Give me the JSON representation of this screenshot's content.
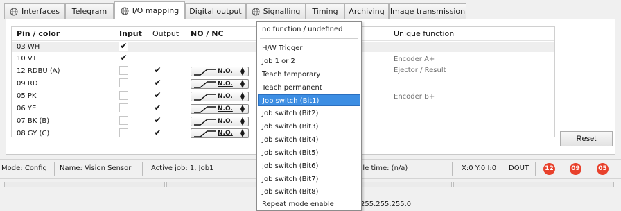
{
  "tabs": [
    {
      "label": "Interfaces",
      "icon": "globe-icon"
    },
    {
      "label": "Telegram"
    },
    {
      "label": "I/O mapping",
      "icon": "globe-icon",
      "active": true
    },
    {
      "label": "Digital output"
    },
    {
      "label": "Signalling",
      "icon": "globe-icon"
    },
    {
      "label": "Timing"
    },
    {
      "label": "Archiving"
    },
    {
      "label": "Image transmission"
    }
  ],
  "table": {
    "headers": {
      "pin": "Pin / color",
      "input": "Input",
      "output": "Output",
      "nonc": "NO / NC",
      "unique": "Unique function"
    },
    "rows": [
      {
        "pin": "03 WH",
        "input": true,
        "output": null,
        "nonc": null,
        "unique": "H/W Trigger",
        "highlight": true
      },
      {
        "pin": "10 VT",
        "input": true,
        "output": null,
        "nonc": null,
        "unique": "Encoder A+"
      },
      {
        "pin": "12 RDBU (A)",
        "input": false,
        "output": true,
        "nonc": "N.O.",
        "unique": "Ejector / Result"
      },
      {
        "pin": "09 RD",
        "input": false,
        "output": true,
        "nonc": "N.O.",
        "unique": ""
      },
      {
        "pin": "05 PK",
        "input": false,
        "output": true,
        "nonc": "N.O.",
        "unique": "Encoder B+"
      },
      {
        "pin": "06 YE",
        "input": false,
        "output": true,
        "nonc": "N.O.",
        "unique": ""
      },
      {
        "pin": "07 BK (B)",
        "input": false,
        "output": true,
        "nonc": "N.O.",
        "unique": ""
      },
      {
        "pin": "08 GY (C)",
        "input": false,
        "output": true,
        "nonc": "N.O.",
        "unique": ""
      }
    ]
  },
  "reset_label": "Reset",
  "status": {
    "mode_label": "Mode:",
    "mode_value": "Config",
    "name_label": "Name:",
    "name_value": "Vision Sensor",
    "active_job_label": "Active job:",
    "active_job_value": "1, Job1",
    "cycle_label": "Cycle time:",
    "cycle_value": "(n/a)",
    "coords": "X:0 Y:0 I:0",
    "dout": "DOUT",
    "leds": [
      "12",
      "09",
      "05"
    ],
    "led_color": "#e8412c"
  },
  "ip_fragment": "255.255.255.0",
  "dropdown": {
    "items": [
      "no function / undefined",
      "H/W Trigger",
      "Job 1 or 2",
      "Teach temporary",
      "Teach permanent",
      "Job switch (Bit1)",
      "Job switch (Bit2)",
      "Job switch (Bit3)",
      "Job switch (Bit4)",
      "Job switch (Bit5)",
      "Job switch (Bit6)",
      "Job switch (Bit7)",
      "Job switch (Bit8)",
      "Repeat mode enable"
    ],
    "selected": "Job switch (Bit1)",
    "selected_color": "#3d8ee3"
  }
}
